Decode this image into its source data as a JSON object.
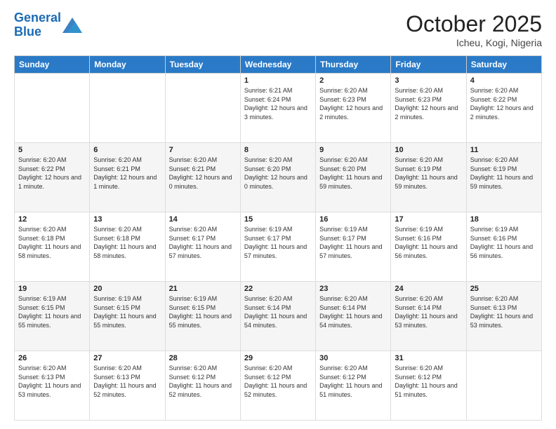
{
  "header": {
    "logo_line1": "General",
    "logo_line2": "Blue",
    "month_title": "October 2025",
    "location": "Icheu, Kogi, Nigeria"
  },
  "days_of_week": [
    "Sunday",
    "Monday",
    "Tuesday",
    "Wednesday",
    "Thursday",
    "Friday",
    "Saturday"
  ],
  "weeks": [
    [
      {
        "day": "",
        "info": ""
      },
      {
        "day": "",
        "info": ""
      },
      {
        "day": "",
        "info": ""
      },
      {
        "day": "1",
        "info": "Sunrise: 6:21 AM\nSunset: 6:24 PM\nDaylight: 12 hours and 3 minutes."
      },
      {
        "day": "2",
        "info": "Sunrise: 6:20 AM\nSunset: 6:23 PM\nDaylight: 12 hours and 2 minutes."
      },
      {
        "day": "3",
        "info": "Sunrise: 6:20 AM\nSunset: 6:23 PM\nDaylight: 12 hours and 2 minutes."
      },
      {
        "day": "4",
        "info": "Sunrise: 6:20 AM\nSunset: 6:22 PM\nDaylight: 12 hours and 2 minutes."
      }
    ],
    [
      {
        "day": "5",
        "info": "Sunrise: 6:20 AM\nSunset: 6:22 PM\nDaylight: 12 hours and 1 minute."
      },
      {
        "day": "6",
        "info": "Sunrise: 6:20 AM\nSunset: 6:21 PM\nDaylight: 12 hours and 1 minute."
      },
      {
        "day": "7",
        "info": "Sunrise: 6:20 AM\nSunset: 6:21 PM\nDaylight: 12 hours and 0 minutes."
      },
      {
        "day": "8",
        "info": "Sunrise: 6:20 AM\nSunset: 6:20 PM\nDaylight: 12 hours and 0 minutes."
      },
      {
        "day": "9",
        "info": "Sunrise: 6:20 AM\nSunset: 6:20 PM\nDaylight: 11 hours and 59 minutes."
      },
      {
        "day": "10",
        "info": "Sunrise: 6:20 AM\nSunset: 6:19 PM\nDaylight: 11 hours and 59 minutes."
      },
      {
        "day": "11",
        "info": "Sunrise: 6:20 AM\nSunset: 6:19 PM\nDaylight: 11 hours and 59 minutes."
      }
    ],
    [
      {
        "day": "12",
        "info": "Sunrise: 6:20 AM\nSunset: 6:18 PM\nDaylight: 11 hours and 58 minutes."
      },
      {
        "day": "13",
        "info": "Sunrise: 6:20 AM\nSunset: 6:18 PM\nDaylight: 11 hours and 58 minutes."
      },
      {
        "day": "14",
        "info": "Sunrise: 6:20 AM\nSunset: 6:17 PM\nDaylight: 11 hours and 57 minutes."
      },
      {
        "day": "15",
        "info": "Sunrise: 6:19 AM\nSunset: 6:17 PM\nDaylight: 11 hours and 57 minutes."
      },
      {
        "day": "16",
        "info": "Sunrise: 6:19 AM\nSunset: 6:17 PM\nDaylight: 11 hours and 57 minutes."
      },
      {
        "day": "17",
        "info": "Sunrise: 6:19 AM\nSunset: 6:16 PM\nDaylight: 11 hours and 56 minutes."
      },
      {
        "day": "18",
        "info": "Sunrise: 6:19 AM\nSunset: 6:16 PM\nDaylight: 11 hours and 56 minutes."
      }
    ],
    [
      {
        "day": "19",
        "info": "Sunrise: 6:19 AM\nSunset: 6:15 PM\nDaylight: 11 hours and 55 minutes."
      },
      {
        "day": "20",
        "info": "Sunrise: 6:19 AM\nSunset: 6:15 PM\nDaylight: 11 hours and 55 minutes."
      },
      {
        "day": "21",
        "info": "Sunrise: 6:19 AM\nSunset: 6:15 PM\nDaylight: 11 hours and 55 minutes."
      },
      {
        "day": "22",
        "info": "Sunrise: 6:20 AM\nSunset: 6:14 PM\nDaylight: 11 hours and 54 minutes."
      },
      {
        "day": "23",
        "info": "Sunrise: 6:20 AM\nSunset: 6:14 PM\nDaylight: 11 hours and 54 minutes."
      },
      {
        "day": "24",
        "info": "Sunrise: 6:20 AM\nSunset: 6:14 PM\nDaylight: 11 hours and 53 minutes."
      },
      {
        "day": "25",
        "info": "Sunrise: 6:20 AM\nSunset: 6:13 PM\nDaylight: 11 hours and 53 minutes."
      }
    ],
    [
      {
        "day": "26",
        "info": "Sunrise: 6:20 AM\nSunset: 6:13 PM\nDaylight: 11 hours and 53 minutes."
      },
      {
        "day": "27",
        "info": "Sunrise: 6:20 AM\nSunset: 6:13 PM\nDaylight: 11 hours and 52 minutes."
      },
      {
        "day": "28",
        "info": "Sunrise: 6:20 AM\nSunset: 6:12 PM\nDaylight: 11 hours and 52 minutes."
      },
      {
        "day": "29",
        "info": "Sunrise: 6:20 AM\nSunset: 6:12 PM\nDaylight: 11 hours and 52 minutes."
      },
      {
        "day": "30",
        "info": "Sunrise: 6:20 AM\nSunset: 6:12 PM\nDaylight: 11 hours and 51 minutes."
      },
      {
        "day": "31",
        "info": "Sunrise: 6:20 AM\nSunset: 6:12 PM\nDaylight: 11 hours and 51 minutes."
      },
      {
        "day": "",
        "info": ""
      }
    ]
  ]
}
